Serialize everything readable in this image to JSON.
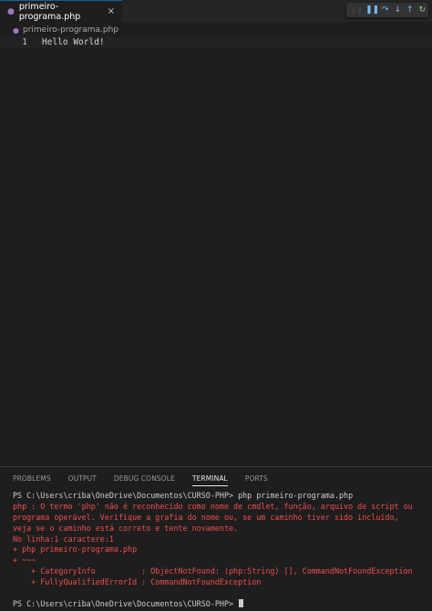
{
  "tab": {
    "icon": "php-elephant-icon",
    "label": "primeiro-programa.php",
    "close_glyph": "×"
  },
  "debug_toolbar": {
    "buttons": [
      {
        "name": "pause-icon",
        "glyph": "❚❚"
      },
      {
        "name": "step-over-icon",
        "glyph": "↷"
      },
      {
        "name": "step-into-icon",
        "glyph": "↓"
      },
      {
        "name": "step-out-icon",
        "glyph": "↑"
      },
      {
        "name": "restart-icon",
        "glyph": "↻"
      }
    ]
  },
  "breadcrumb": {
    "icon": "php-elephant-icon",
    "label": "primeiro-programa.php"
  },
  "editor": {
    "lines": [
      {
        "number": "1",
        "text": "Hello World!"
      }
    ]
  },
  "panel": {
    "tabs": [
      {
        "label": "PROBLEMS",
        "active": false
      },
      {
        "label": "OUTPUT",
        "active": false
      },
      {
        "label": "DEBUG CONSOLE",
        "active": false
      },
      {
        "label": "TERMINAL",
        "active": true
      },
      {
        "label": "PORTS",
        "active": false
      }
    ]
  },
  "terminal": {
    "lines": [
      {
        "text": "PS C:\\Users\\criba\\OneDrive\\Documentos\\CURSO-PHP> php primeiro-programa.php",
        "kind": "plain"
      },
      {
        "text": "php : O termo 'php' não é reconhecido como nome de cmdlet, função, arquivo de script ou",
        "kind": "err"
      },
      {
        "text": "programa operável. Verifique a grafia do nome ou, se um caminho tiver sido incluído,",
        "kind": "err"
      },
      {
        "text": "veja se o caminho está correto e tente novamente.",
        "kind": "err"
      },
      {
        "text": "No linha:1 caractere:1",
        "kind": "err"
      },
      {
        "text": "+ php primeiro-programa.php",
        "kind": "err"
      },
      {
        "text": "+ ~~~",
        "kind": "err"
      },
      {
        "text": "    + CategoryInfo          : ObjectNotFound: (php:String) [], CommandNotFoundException",
        "kind": "err"
      },
      {
        "text": "    + FullyQualifiedErrorId : CommandNotFoundException",
        "kind": "err"
      },
      {
        "text": "",
        "kind": "plain"
      },
      {
        "text": "PS C:\\Users\\criba\\OneDrive\\Documentos\\CURSO-PHP> ",
        "kind": "plain",
        "cursor": true
      }
    ]
  },
  "colors": {
    "background": "#1e1e1e",
    "error_text": "#f14c4c",
    "php_icon": "#a074c4",
    "debug_icon": "#75beff"
  }
}
